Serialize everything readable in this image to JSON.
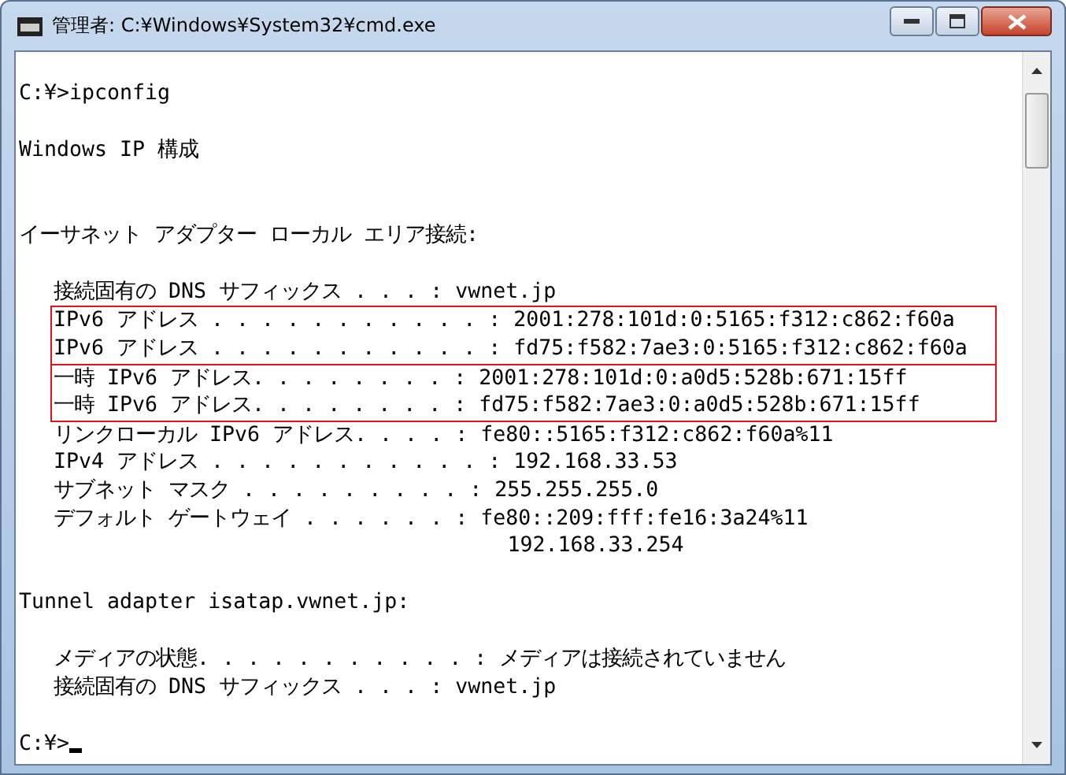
{
  "window": {
    "title": "管理者: C:¥Windows¥System32¥cmd.exe"
  },
  "console": {
    "sections": [
      {
        "kind": "plain",
        "blocks": [
          {
            "highlighted": false,
            "lines": [
              "C:¥>ipconfig"
            ]
          }
        ]
      },
      {
        "kind": "plain",
        "blocks": [
          {
            "highlighted": false,
            "lines": [
              "Windows IP 構成"
            ]
          }
        ]
      },
      {
        "kind": "plain",
        "blocks": [
          {
            "highlighted": false,
            "lines": [
              "イーサネット アダプター ローカル エリア接続:"
            ]
          }
        ]
      },
      {
        "kind": "detail",
        "blocks": [
          {
            "highlighted": false,
            "lines": [
              "接続固有の DNS サフィックス . . . : vwnet.jp"
            ]
          },
          {
            "highlighted": true,
            "lines": [
              "IPv6 アドレス . . . . . . . . . . . : 2001:278:101d:0:5165:f312:c862:f60a",
              "IPv6 アドレス . . . . . . . . . . . : fd75:f582:7ae3:0:5165:f312:c862:f60a"
            ]
          },
          {
            "highlighted": true,
            "lines": [
              "一時 IPv6 アドレス. . . . . . . . : 2001:278:101d:0:a0d5:528b:671:15ff",
              "一時 IPv6 アドレス. . . . . . . . : fd75:f582:7ae3:0:a0d5:528b:671:15ff"
            ]
          },
          {
            "highlighted": false,
            "lines": [
              "リンクローカル IPv6 アドレス. . . . : fe80::5165:f312:c862:f60a%11",
              "IPv4 アドレス . . . . . . . . . . . : 192.168.33.53",
              "サブネット マスク . . . . . . . . . : 255.255.255.0",
              "デフォルト ゲートウェイ . . . . . . : fe80::209:fff:fe16:3a24%11",
              "                                    192.168.33.254"
            ]
          }
        ]
      },
      {
        "kind": "plain",
        "blocks": [
          {
            "highlighted": false,
            "lines": [
              "Tunnel adapter isatap.vwnet.jp:"
            ]
          }
        ]
      },
      {
        "kind": "detail",
        "blocks": [
          {
            "highlighted": false,
            "lines": [
              "メディアの状態. . . . . . . . . . . : メディアは接続されていません",
              "接続固有の DNS サフィックス . . . : vwnet.jp"
            ]
          }
        ]
      },
      {
        "kind": "prompt",
        "blocks": [
          {
            "highlighted": false,
            "lines": [
              "C:¥>"
            ]
          }
        ]
      }
    ]
  }
}
